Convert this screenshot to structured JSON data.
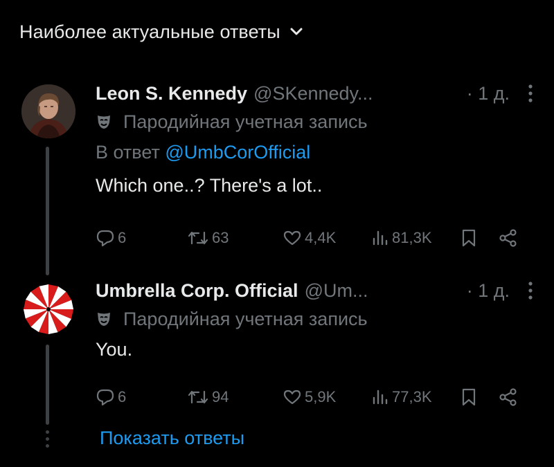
{
  "header": {
    "sort_label": "Наиболее актуальные ответы",
    "chevron_icon": "chevron-down-icon"
  },
  "tweets": [
    {
      "name": "Leon S. Kennedy",
      "handle": "@SKennedy...",
      "time": "· 1 д.",
      "parody_label": "Пародийная учетная запись",
      "reply_prefix": "В ответ",
      "reply_mention": "@UmbCorOfficial",
      "text": "Which one..? There's a lot..",
      "replies": "6",
      "reposts": "63",
      "likes": "4,4K",
      "views": "81,3K"
    },
    {
      "name": "Umbrella Corp. Official",
      "handle": "@Um...",
      "time": "· 1 д.",
      "parody_label": "Пародийная учетная запись",
      "text": "You.",
      "replies": "6",
      "reposts": "94",
      "likes": "5,9K",
      "views": "77,3K"
    }
  ],
  "footer": {
    "show_replies": "Показать ответы"
  },
  "colors": {
    "background": "#000000",
    "text": "#e7e9ea",
    "muted": "#71767b",
    "link": "#1d9bf0",
    "thread": "#3e4144",
    "umbrella_red": "#d81b1b"
  }
}
